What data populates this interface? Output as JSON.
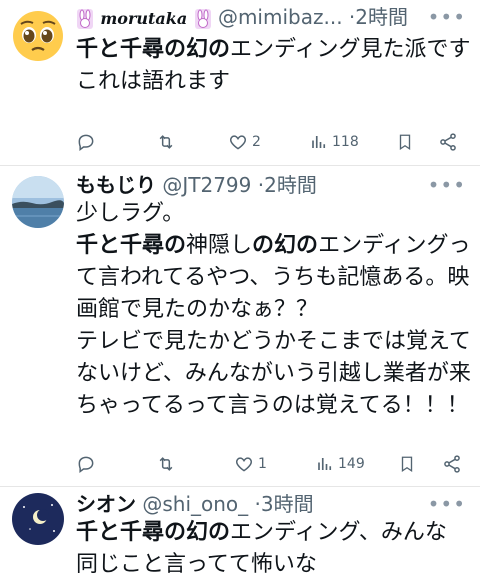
{
  "tweets": [
    {
      "avatar": "pleading-face-emoji",
      "name": "morutaka",
      "handle": "@mimibaz...",
      "dot": "·",
      "time": "2時間",
      "body": [
        {
          "bold": "千と千尋の幻の",
          "text": "エンディング見た派です"
        },
        {
          "text": "これは語れます"
        }
      ],
      "actions": {
        "reply": "",
        "retweet": "",
        "like": "2",
        "views": "118"
      }
    },
    {
      "avatar": "landscape-photo",
      "name": "ももじり",
      "handle": "@JT2799",
      "dot": "·",
      "time": "2時間",
      "body_html_parts": {
        "p1": "少しラグ。",
        "p2b": "千と千尋の",
        "p2": "神隠し",
        "p2c": "の",
        "p2b2": "幻の",
        "p2d": "エンディング",
        "p3": "って言われてるやつ、うちも記憶ある。映画館で見たのかなぁ？？",
        "p4": "テレビで見たかどうかそこまでは覚えてないけど、みんながいう引越し業者が来ちゃってるって言うのは覚えてる！！！"
      },
      "actions": {
        "reply": "",
        "retweet": "",
        "like": "1",
        "views": "149"
      }
    },
    {
      "avatar": "night-sky-moon",
      "name": "シオン",
      "handle": "@shi_ono_",
      "dot": "·",
      "time": "3時間",
      "body": [
        {
          "bold": "千と千尋の幻の",
          "text": "エンディング、みんな"
        },
        {
          "text": "同じこと言ってて怖いな"
        }
      ]
    }
  ],
  "more_icon": "more-dots-icon"
}
